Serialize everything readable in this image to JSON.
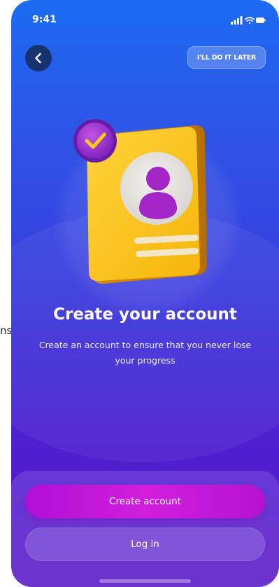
{
  "stray_text": "ns",
  "status_bar": {
    "time": "9:41",
    "icons": [
      "cellular-signal-icon",
      "wifi-icon",
      "battery-icon"
    ]
  },
  "header": {
    "back_icon": "chevron-left-icon",
    "skip_label": "I'LL DO IT LATER"
  },
  "illustration": {
    "description_icon": "profile-card-icon",
    "badge_icon": "check-badge-icon"
  },
  "content": {
    "title": "Create your account",
    "subtitle": "Create an account to ensure that you never lose your progress"
  },
  "actions": {
    "primary_label": "Create account",
    "secondary_label": "Log in"
  },
  "colors": {
    "background_top": "#1b6bf3",
    "background_bottom": "#5a16c8",
    "primary_button": "#c416d8",
    "card_yellow": "#f8c11c",
    "avatar_purple": "#a426c8"
  }
}
